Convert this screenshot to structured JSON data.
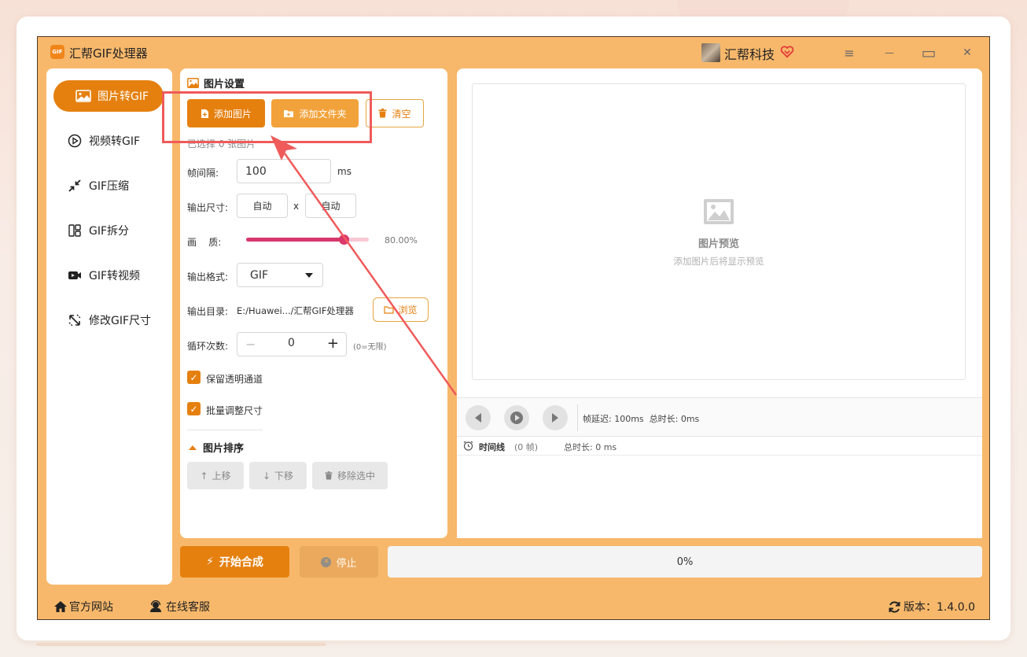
{
  "app": {
    "logo_text": "GIF",
    "title": "汇帮GIF处理器"
  },
  "user": {
    "name": "汇帮科技"
  },
  "window_controls": {
    "menu": "≡",
    "minimize": "—",
    "maximize": "▭",
    "close": "✕"
  },
  "sidebar": {
    "items": [
      {
        "label": "图片转GIF",
        "icon": "image-icon",
        "active": true
      },
      {
        "label": "视频转GIF",
        "icon": "play-circle-icon"
      },
      {
        "label": "GIF压缩",
        "icon": "compress-icon"
      },
      {
        "label": "GIF拆分",
        "icon": "split-icon"
      },
      {
        "label": "GIF转视频",
        "icon": "video-icon"
      },
      {
        "label": "修改GIF尺寸",
        "icon": "resize-icon"
      }
    ]
  },
  "settings": {
    "title": "图片设置",
    "add_image": "添加图片",
    "add_folder": "添加文件夹",
    "clear": "清空",
    "selected_count": "已选择 0 张图片",
    "frame_interval_label": "帧间隔:",
    "frame_interval_value": "100",
    "frame_interval_unit": "ms",
    "output_size_label": "输出尺寸:",
    "width_value": "自动",
    "size_sep": "x",
    "height_value": "自动",
    "quality_label": "画    质:",
    "quality_value": "80.00%",
    "quality_fraction": 0.8,
    "format_label": "输出格式:",
    "format_value": "GIF",
    "output_dir_label": "输出目录:",
    "output_dir_value": "E:/Huawei.../汇帮GIF处理器",
    "browse": "浏览",
    "loop_label": "循环次数:",
    "loop_value": "0",
    "loop_hint": "(0=无限)",
    "keep_alpha": "保留透明通道",
    "batch_resize": "批量调整尺寸",
    "sort_title": "图片排序",
    "move_up": "上移",
    "move_down": "下移",
    "remove_selected": "移除选中"
  },
  "preview": {
    "title": "图片预览",
    "subtitle": "添加图片后将显示预览",
    "frame_info": "帧延迟: 100ms  总时长: 0ms",
    "timeline_label": "时间线",
    "timeline_frames": "(0 帧)",
    "timeline_total": "总时长: 0 ms"
  },
  "actions": {
    "start": "开始合成",
    "stop": "停止",
    "progress": "0%"
  },
  "footer": {
    "website": "官方网站",
    "support": "在线客服",
    "version": "版本：1.4.0.0"
  },
  "colors": {
    "accent": "#e5800f",
    "window_bg": "#f7b86b",
    "annotation": "#ef5a5a"
  }
}
